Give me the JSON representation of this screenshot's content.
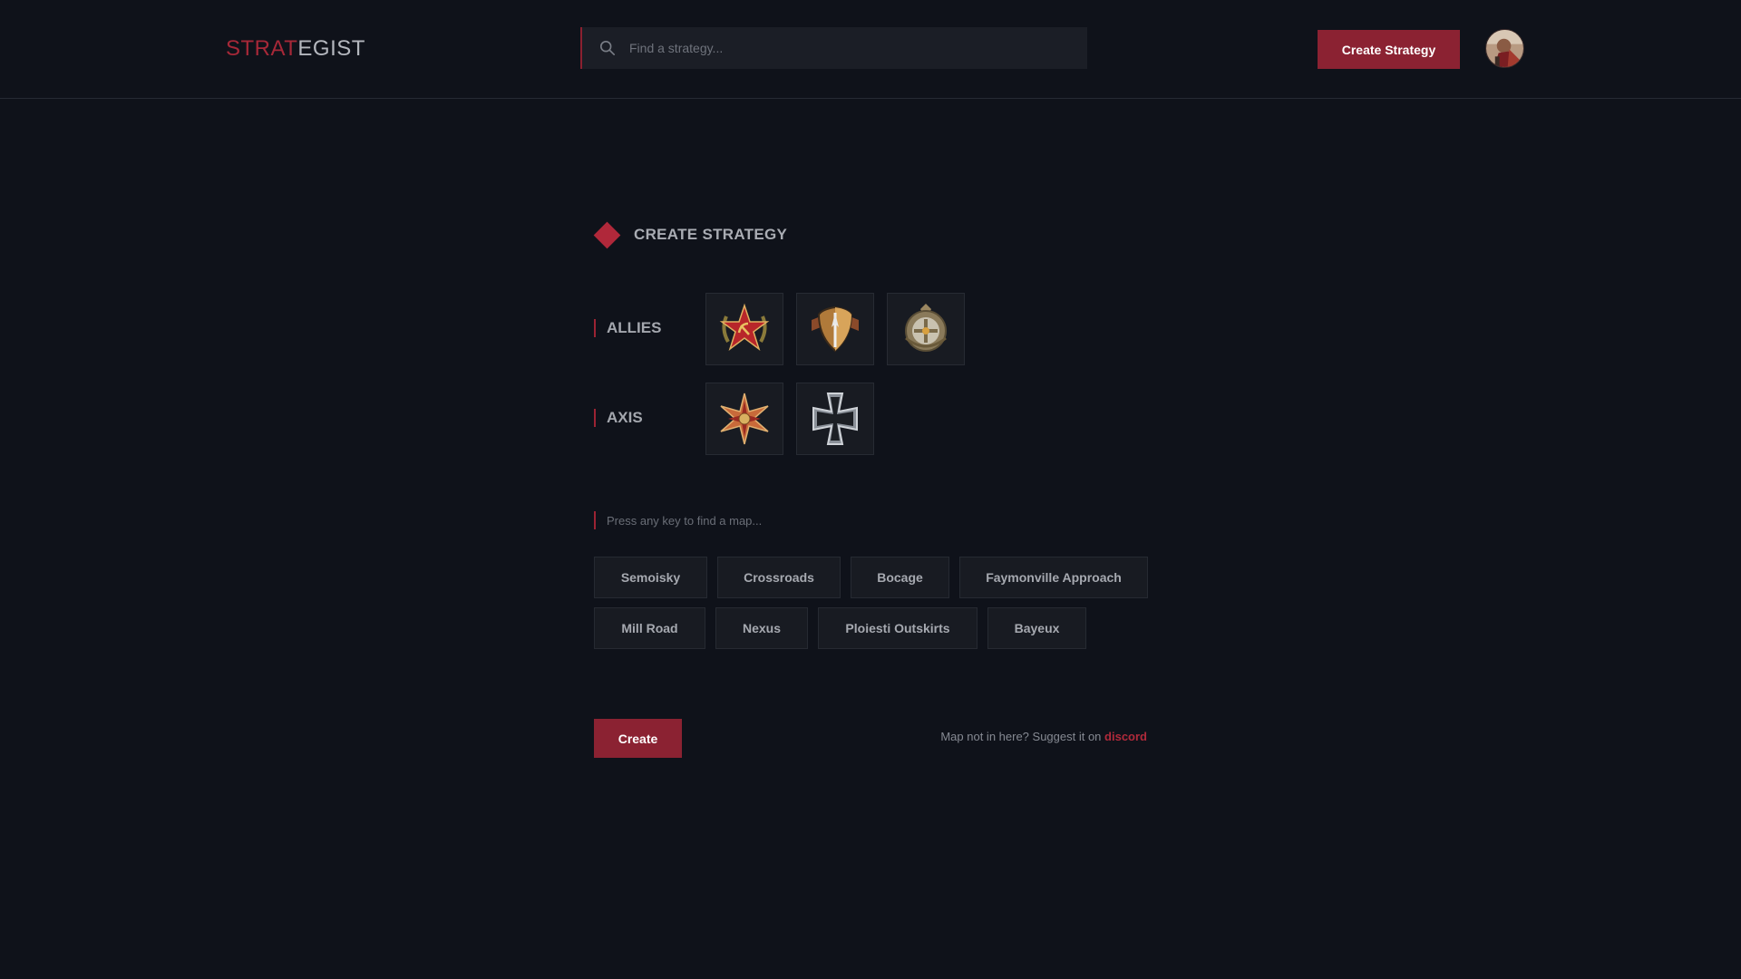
{
  "brand": {
    "logo_part1": "STRAT",
    "logo_part2": "EGIST"
  },
  "header": {
    "search_placeholder": "Find a strategy...",
    "create_button": "Create Strategy",
    "avatar_icon": "user-avatar"
  },
  "main": {
    "title": "CREATE STRATEGY",
    "allies": {
      "label": "ALLIES",
      "factions": [
        {
          "icon": "soviet-star-emblem-icon"
        },
        {
          "icon": "us-shield-emblem-icon"
        },
        {
          "icon": "british-badge-emblem-icon"
        }
      ]
    },
    "axis": {
      "label": "AXIS",
      "factions": [
        {
          "icon": "oberkommando-star-emblem-icon"
        },
        {
          "icon": "iron-cross-emblem-icon"
        }
      ]
    },
    "map_search_placeholder": "Press any key to find a map...",
    "maps": [
      "Semoisky",
      "Crossroads",
      "Bocage",
      "Faymonville Approach",
      "Mill Road",
      "Nexus",
      "Ploiesti Outskirts",
      "Bayeux"
    ],
    "create_button": "Create",
    "suggest_text": "Map not in here? Suggest it on",
    "suggest_link": "discord"
  },
  "colors": {
    "background": "#0f121a",
    "accent": "#8b2232",
    "accent_bright": "#b0283a"
  }
}
